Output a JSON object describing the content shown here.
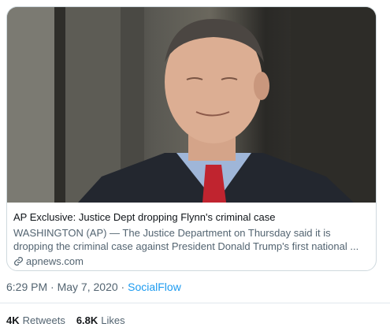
{
  "card": {
    "title": "AP Exclusive: Justice Dept dropping Flynn's criminal case",
    "description": "WASHINGTON (AP) — The Justice Department on Thursday said it is dropping the criminal case against President Donald Trump's first national ...",
    "domain": "apnews.com",
    "link_icon": "link-icon"
  },
  "tweet_meta": {
    "time": "6:29 PM",
    "separator": "·",
    "date": "May 7, 2020",
    "source": "SocialFlow"
  },
  "stats": {
    "retweets_count": "4K",
    "retweets_label": "Retweets",
    "likes_count": "6.8K",
    "likes_label": "Likes"
  },
  "colors": {
    "accent": "#1d9bf0",
    "secondary_text": "#536471",
    "border": "#cfd9de"
  }
}
